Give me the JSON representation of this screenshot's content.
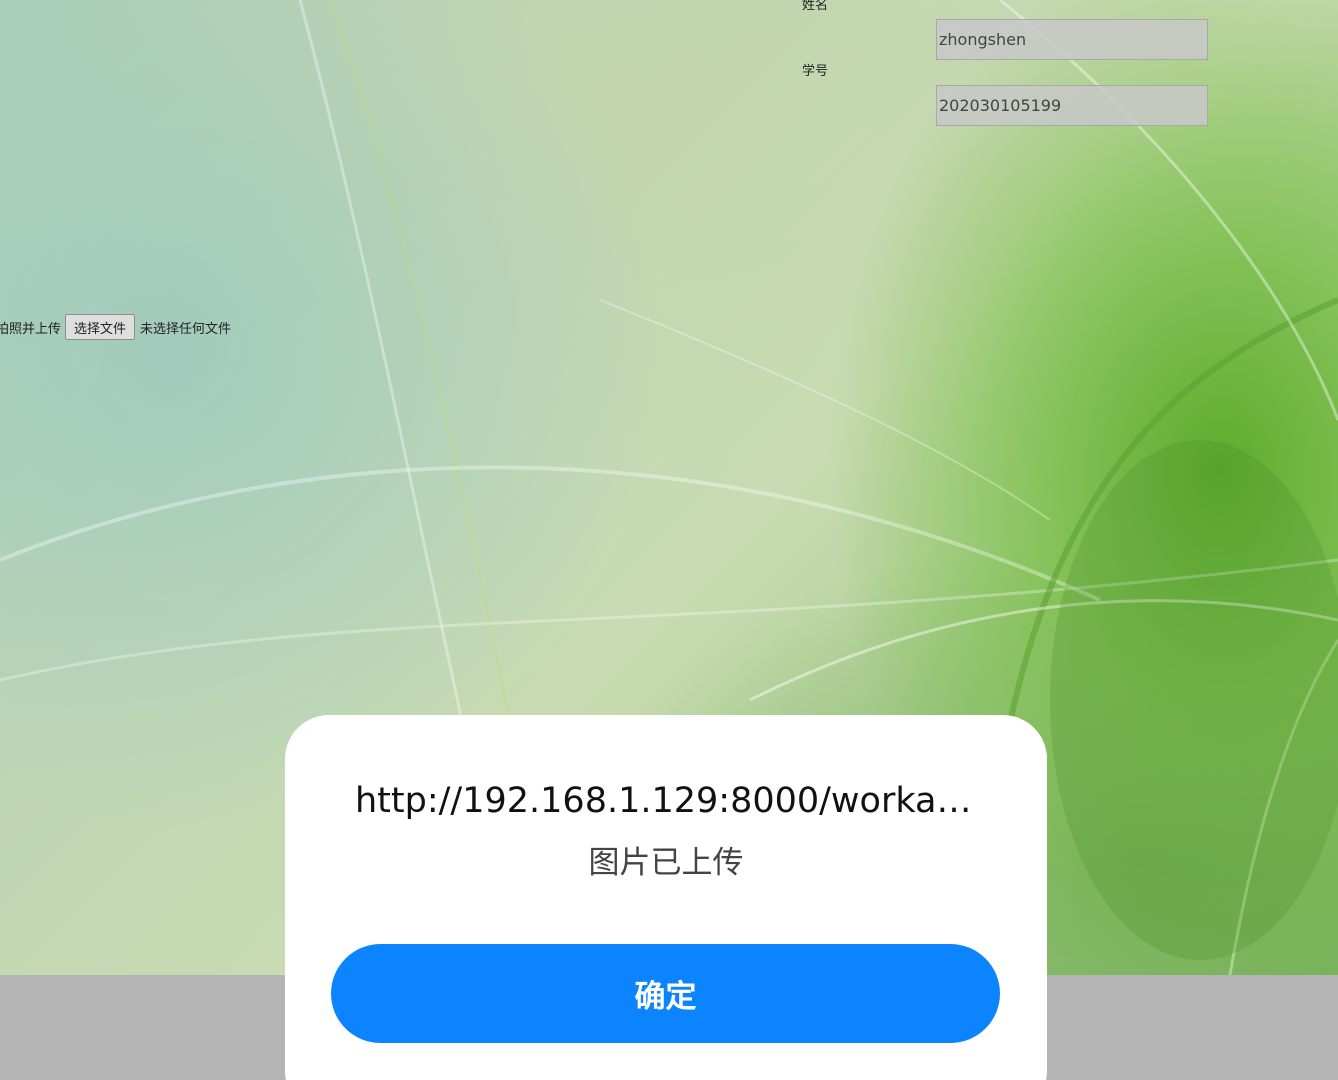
{
  "form": {
    "name_label": "姓名",
    "name_value": "zhongshen",
    "student_id_label": "学号",
    "student_id_value": "202030105199",
    "upload_label": "拍照并上传",
    "choose_file_label": "选择文件",
    "no_file_text": "未选择任何文件"
  },
  "dialog": {
    "title": "http://192.168.1.129:8000/workat...",
    "message": "图片已上传",
    "confirm_label": "确定"
  },
  "colors": {
    "confirm_button": "#0d84ff",
    "dialog_background": "#ffffff",
    "page_bottom": "#b4b4b4",
    "background_green": "#7fb862"
  }
}
